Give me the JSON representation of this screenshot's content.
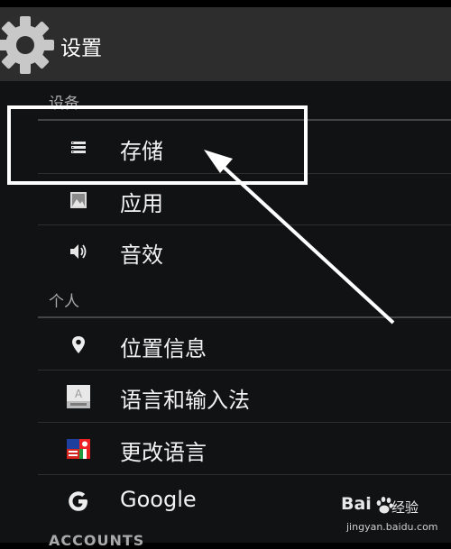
{
  "app": {
    "title": "设置"
  },
  "sections": [
    {
      "header": "设备",
      "items": [
        {
          "label": "存储",
          "icon": "storage-icon"
        },
        {
          "label": "应用",
          "icon": "apps-icon"
        },
        {
          "label": "音效",
          "icon": "sound-icon"
        }
      ]
    },
    {
      "header": "个人",
      "items": [
        {
          "label": "位置信息",
          "icon": "location-icon"
        },
        {
          "label": "语言和输入法",
          "icon": "keyboard-icon"
        },
        {
          "label": "更改语言",
          "icon": "flag-icon"
        },
        {
          "label": "Google",
          "icon": "google-icon"
        }
      ]
    },
    {
      "header": "ACCOUNTS",
      "items": []
    }
  ],
  "watermark": {
    "brand": "Bai",
    "brand2": "经验",
    "url": "jingyan.baidu.com"
  },
  "colors": {
    "action_bar": "#2d2d2d",
    "list_bg": "#111214",
    "highlight": "#ffffff"
  }
}
